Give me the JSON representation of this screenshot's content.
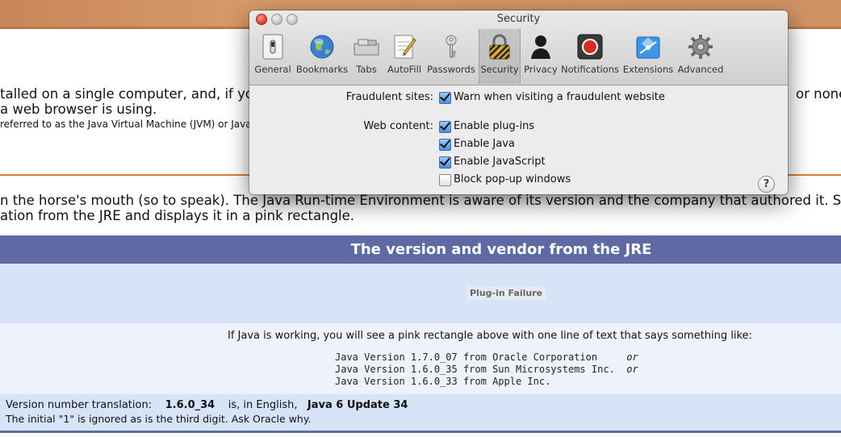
{
  "background_page": {
    "line1_left": "talled on a single computer, and, if yo",
    "line1_right": "or none",
    "line2": " a web browser is using.",
    "line3": " referred to as the Java Virtual Machine (JVM) or Java",
    "line4": "n the horse's mouth (so to speak). The Java Run-time Environment is aware of its version and the company that authored it. So",
    "line5": "ation from the JRE and displays it in a pink rectangle.",
    "jre_header": "The version and vendor from the JRE",
    "plugin_failure": "Plug-in Failure",
    "info_line": "If Java is working, you will see a pink rectangle above with one line of text that says something like:",
    "examples": [
      {
        "text": "Java Version 1.7.0_07 from Oracle Corporation     ",
        "or": "or"
      },
      {
        "text": "Java Version 1.6.0_35 from Sun Microsystems Inc.  ",
        "or": "or"
      },
      {
        "text": "Java Version 1.6.0_33 from Apple Inc.",
        "or": ""
      }
    ],
    "translation": {
      "prefix": "Version number translation:",
      "version": "1.6.0_34",
      "middle": "is, in English,",
      "english": "Java 6 Update 34",
      "note": "The initial \"1\" is ignored as is the third digit. Ask Oracle why."
    },
    "colors": {
      "header": "#5f6aa4",
      "light_blue": "#d7e3f6",
      "orange_rule": "#e07a30"
    }
  },
  "window": {
    "title": "Security",
    "toolbar": [
      {
        "label": "General",
        "icon": "general-switch-icon"
      },
      {
        "label": "Bookmarks",
        "icon": "globe-icon"
      },
      {
        "label": "Tabs",
        "icon": "tabs-icon"
      },
      {
        "label": "AutoFill",
        "icon": "autofill-pencil-icon"
      },
      {
        "label": "Passwords",
        "icon": "key-icon"
      },
      {
        "label": "Security",
        "icon": "lock-icon",
        "selected": true
      },
      {
        "label": "Privacy",
        "icon": "person-silhouette-icon"
      },
      {
        "label": "Notifications",
        "icon": "notifications-icon"
      },
      {
        "label": "Extensions",
        "icon": "puzzle-icon"
      },
      {
        "label": "Advanced",
        "icon": "gear-icon"
      }
    ],
    "fraudulent": {
      "label": "Fraudulent sites:",
      "option": "Warn when visiting a fraudulent website",
      "checked": true
    },
    "web_content": {
      "label": "Web content:",
      "options": [
        {
          "label": "Enable plug-ins",
          "checked": true
        },
        {
          "label": "Enable Java",
          "checked": true
        },
        {
          "label": "Enable JavaScript",
          "checked": true
        },
        {
          "label": "Block pop-up windows",
          "checked": false
        }
      ]
    },
    "help": "?"
  }
}
